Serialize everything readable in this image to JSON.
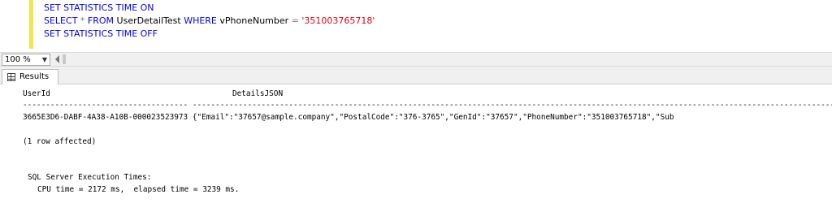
{
  "editor": {
    "line1": {
      "kw": "SET STATISTICS TIME ON"
    },
    "line2": {
      "kw_select": "SELECT",
      "star": "*",
      "kw_from": "FROM",
      "table": "UserDetailTest",
      "kw_where": "WHERE",
      "column": "vPhoneNumber",
      "eq": "=",
      "value": "'351003765718'"
    },
    "line3": {
      "kw": "SET STATISTICS TIME OFF"
    }
  },
  "zoom": {
    "value": "100 %"
  },
  "results_tab": {
    "label": "Results"
  },
  "results": {
    "header_userid": "UserId",
    "header_details": "DetailsJSON",
    "separator": "------------------------------------ ----------------------------------------------------------------------------------------------------------------------------------------------------",
    "row_userid": "3665E3D6-DABF-4A38-A10B-000023523973",
    "row_details": "{\"Email\":\"37657@sample.company\",\"PostalCode\":\"376-3765\",\"GenId\":\"37657\",\"PhoneNumber\":\"351003765718\",\"Sub",
    "rows_affected": "(1 row affected)",
    "exec_title": "SQL Server Execution Times:",
    "exec_times": "CPU time = 2172 ms,  elapsed time = 3239 ms."
  },
  "colors": {
    "keyword": "#0000ff",
    "string": "#e0000e",
    "operator": "#808080",
    "changebar": "#f5e34a"
  }
}
